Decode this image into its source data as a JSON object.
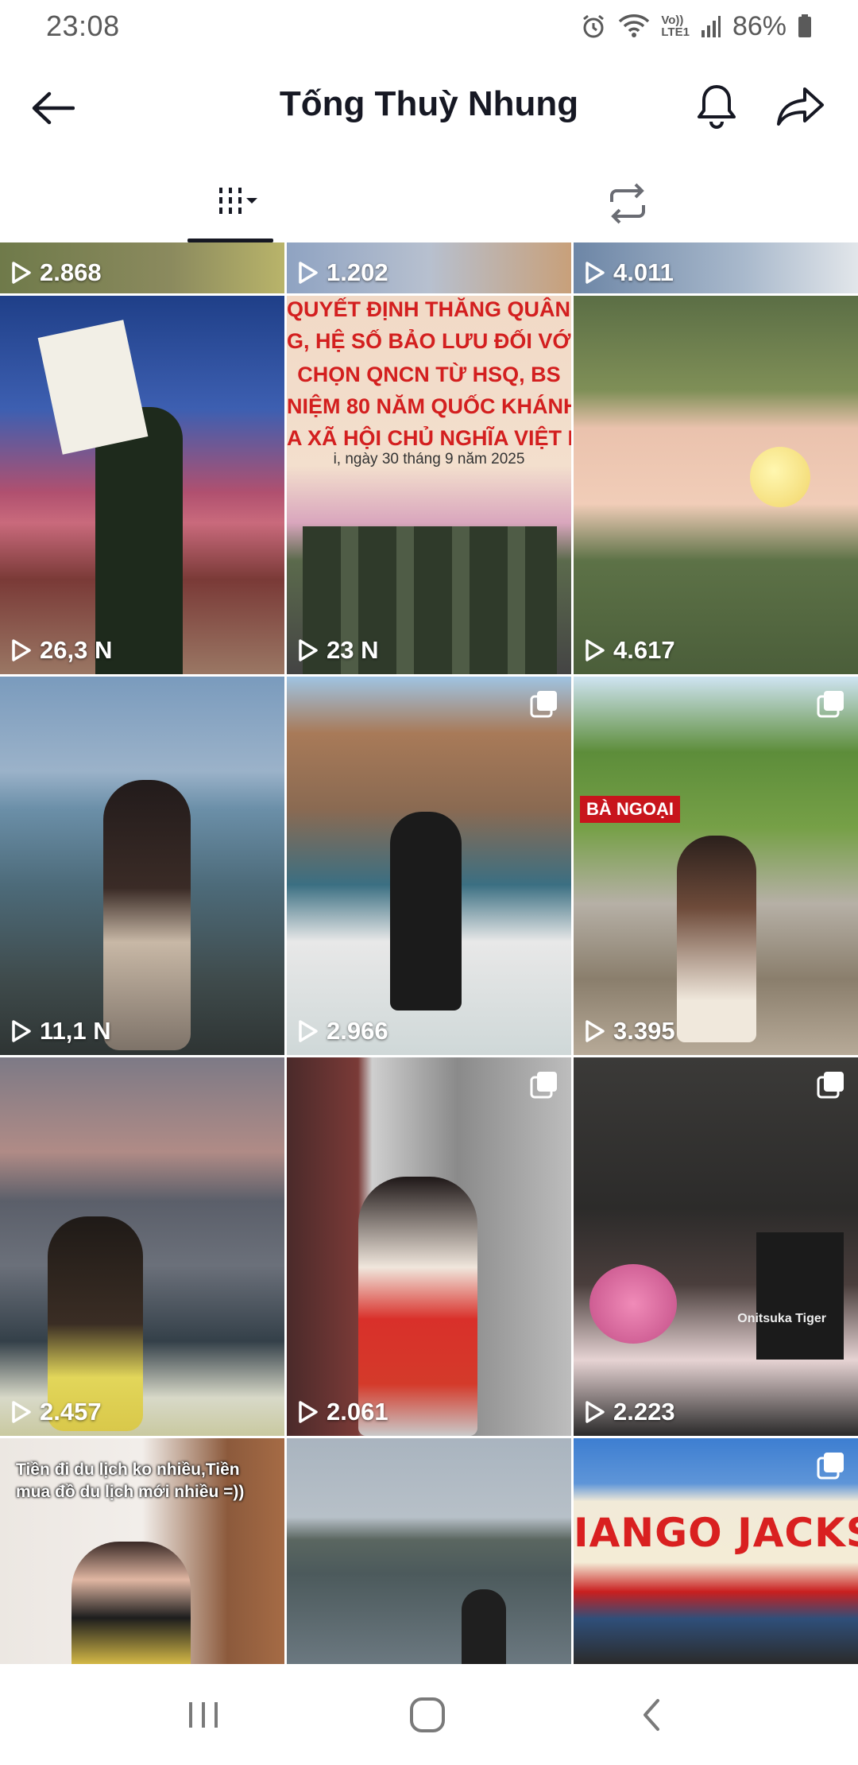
{
  "status": {
    "time": "23:08",
    "battery": "86%",
    "network": "LTE1",
    "volte": "Vo))"
  },
  "header": {
    "title": "Tống Thuỳ Nhung"
  },
  "tabs": [
    {
      "name": "videos",
      "icon": "grid-bars-icon",
      "active": true
    },
    {
      "name": "reposts",
      "icon": "repost-icon",
      "active": false
    }
  ],
  "grid": {
    "partial_row": [
      "2.868",
      "1.202",
      "4.011"
    ],
    "rows": [
      [
        {
          "views": "26,3 N"
        },
        {
          "views": "23 N",
          "banner_1": "QUYẾT ĐỊNH THĂNG QUÂN HÀM",
          "banner_2": "G, HỆ SỐ BẢO LƯU ĐỐI VỚI QNCN",
          "banner_3": "CHỌN QNCN TỪ HSQ, BS",
          "banner_4": "NIỆM 80 NĂM QUỐC KHÁNH",
          "banner_5": "A XÃ HỘI CHỦ NGHĨA VIỆT NAM",
          "date_line": "i, ngày 30 tháng 9 năm 2025"
        },
        {
          "views": "4.617"
        }
      ],
      [
        {
          "views": "11,1 N"
        },
        {
          "views": "2.966"
        },
        {
          "views": "3.395",
          "shop_tag": "BÀ NGOẠI"
        }
      ],
      [
        {
          "views": "2.457"
        },
        {
          "views": "2.061"
        },
        {
          "views": "2.223",
          "brand": "Onitsuka Tiger"
        }
      ],
      [
        {
          "overlay": "Tiền đi du lịch ko nhiều,Tiền mua đồ du lịch mới nhiều =))"
        },
        {},
        {
          "sign": "IANGO JACKS PIZ"
        }
      ]
    ]
  },
  "colors": {
    "text_primary": "#161823",
    "status_gray": "#5a5a5a",
    "divider": "#ffffff"
  }
}
